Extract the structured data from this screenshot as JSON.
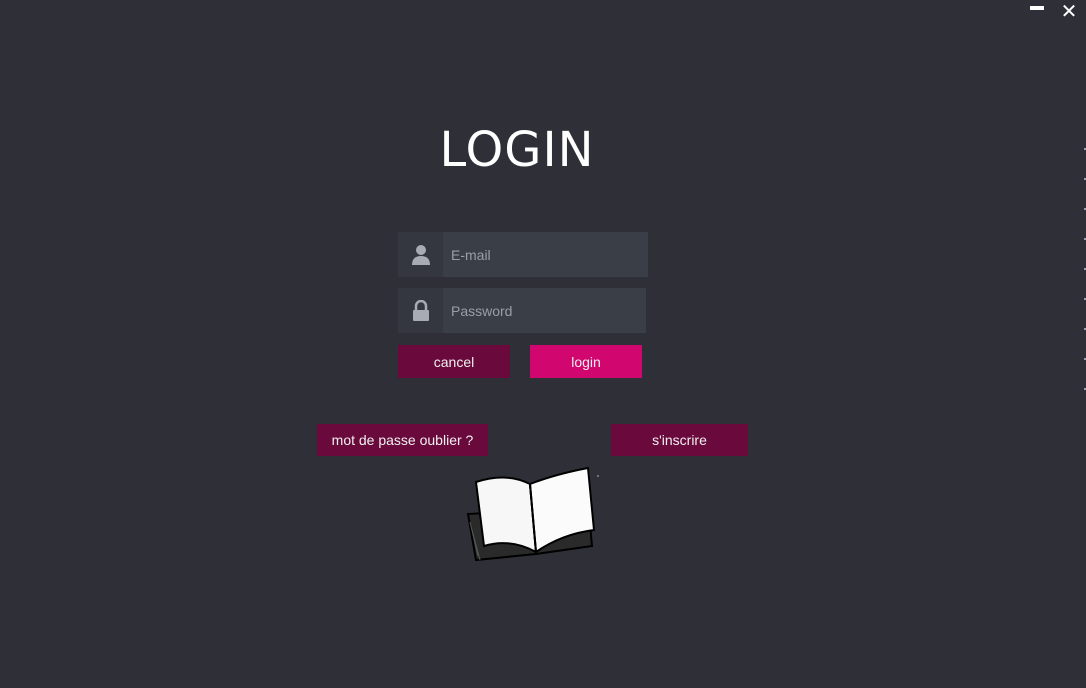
{
  "window": {
    "minimize_label": "minimize",
    "close_label": "close"
  },
  "title": "LOGIN",
  "email": {
    "placeholder": "E-mail",
    "value": "",
    "icon": "user-icon"
  },
  "password": {
    "placeholder": "Password",
    "value": "",
    "icon": "lock-icon"
  },
  "buttons": {
    "cancel": "cancel",
    "login": "login",
    "forgot": "mot de passe oublier ?",
    "signup": "s'inscrire"
  },
  "colors": {
    "background": "#2f2f37",
    "field": "#3a3e47",
    "button_dark": "#6a0a3c",
    "button_accent": "#d1066f"
  },
  "illustration": {
    "icon": "open-book-icon"
  }
}
